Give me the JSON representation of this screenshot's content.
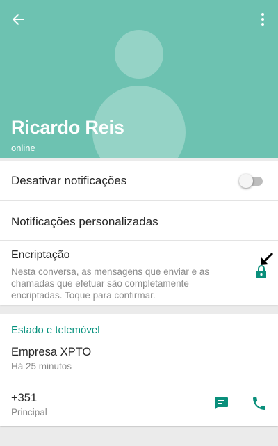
{
  "header": {
    "name": "Ricardo Reis",
    "status": "online",
    "icons": {
      "back": "arrow-left-icon",
      "menu": "more-vert-icon",
      "avatar": "default-avatar-icon"
    },
    "colors": {
      "background": "#6dc2b1"
    }
  },
  "settings": {
    "mute": {
      "label": "Desativar notificações",
      "enabled": false
    },
    "custom": {
      "label": "Notificações personalizadas"
    },
    "encryption": {
      "label": "Encriptação",
      "description": "Nesta conversa, as mensagens que enviar e as chamadas que efetuar são completamente encriptadas. Toque para confirmar.",
      "icon": "lock-icon"
    }
  },
  "about": {
    "section_title": "Estado e telemóvel",
    "status_text": "Empresa XPTO",
    "status_time": "Há 25 minutos",
    "phone_number": "+351",
    "phone_label": "Principal",
    "icons": {
      "message": "message-icon",
      "call": "phone-icon"
    }
  },
  "colors": {
    "accent": "#06917d",
    "toggle_off": "#bdbdbd"
  }
}
